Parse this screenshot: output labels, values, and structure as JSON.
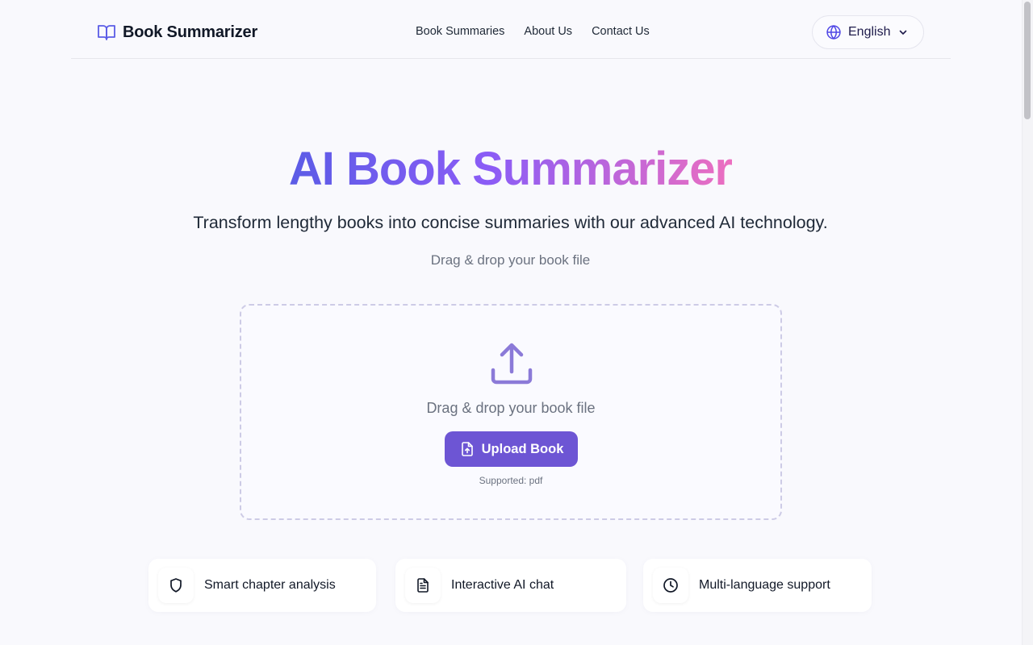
{
  "header": {
    "brand": "Book Summarizer",
    "nav": [
      "Book Summaries",
      "About Us",
      "Contact Us"
    ],
    "language": "English"
  },
  "hero": {
    "title": "AI Book Summarizer",
    "subtitle": "Transform lengthy books into concise summaries with our advanced AI technology.",
    "hint": "Drag & drop your book file"
  },
  "dropzone": {
    "text": "Drag & drop your book file",
    "button_label": "Upload Book",
    "supported": "Supported: pdf"
  },
  "features": [
    {
      "icon": "shield-icon",
      "label": "Smart chapter analysis"
    },
    {
      "icon": "document-icon",
      "label": "Interactive AI chat"
    },
    {
      "icon": "clock-icon",
      "label": "Multi-language support"
    }
  ],
  "colors": {
    "accent": "#6d55d4",
    "gradient_start": "#5b5ce6",
    "gradient_mid": "#8b5cf6",
    "gradient_end": "#ec6fc0"
  }
}
